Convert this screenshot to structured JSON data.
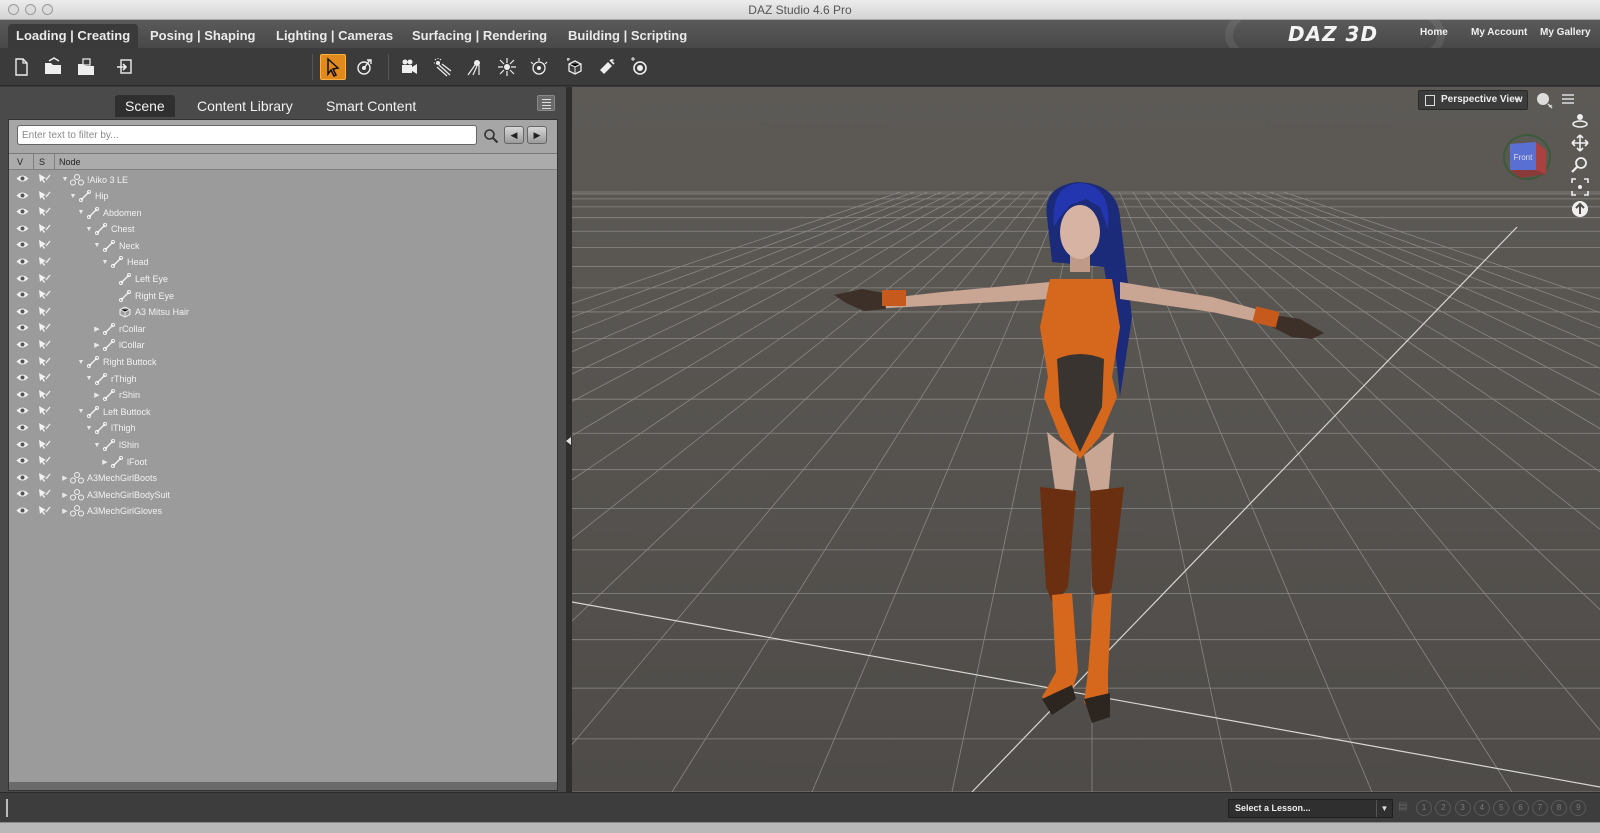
{
  "window": {
    "title": "DAZ Studio 4.6 Pro"
  },
  "workspace_tabs": [
    {
      "label": "Loading | Creating",
      "active": true
    },
    {
      "label": "Posing | Shaping",
      "active": false
    },
    {
      "label": "Lighting | Cameras",
      "active": false
    },
    {
      "label": "Surfacing | Rendering",
      "active": false
    },
    {
      "label": "Building | Scripting",
      "active": false
    }
  ],
  "brand": {
    "logo_text": "DAZ 3D"
  },
  "top_links": {
    "home": "Home",
    "account": "My Account",
    "gallery": "My Gallery"
  },
  "toolbar": {
    "file_tools": [
      "new-file-icon",
      "open-file-icon",
      "merge-file-icon",
      "import-icon"
    ],
    "active_tool": "node-selection-icon",
    "accent_color": "#e08a1e"
  },
  "pane": {
    "tabs": [
      {
        "label": "Scene",
        "active": true
      },
      {
        "label": "Content Library",
        "active": false
      },
      {
        "label": "Smart Content",
        "active": false
      }
    ],
    "filter_placeholder": "Enter text to filter by...",
    "columns": {
      "visible": "V",
      "selectable": "S",
      "node": "Node"
    }
  },
  "scene_nodes": [
    {
      "label": "!Aiko 3 LE",
      "depth": 0,
      "expand": "open",
      "icon": "figure"
    },
    {
      "label": "Hip",
      "depth": 1,
      "expand": "open",
      "icon": "bone"
    },
    {
      "label": "Abdomen",
      "depth": 2,
      "expand": "open",
      "icon": "bone"
    },
    {
      "label": "Chest",
      "depth": 3,
      "expand": "open",
      "icon": "bone"
    },
    {
      "label": "Neck",
      "depth": 4,
      "expand": "open",
      "icon": "bone"
    },
    {
      "label": "Head",
      "depth": 5,
      "expand": "open",
      "icon": "bone"
    },
    {
      "label": "Left Eye",
      "depth": 6,
      "expand": "none",
      "icon": "bone"
    },
    {
      "label": "Right Eye",
      "depth": 6,
      "expand": "none",
      "icon": "bone"
    },
    {
      "label": "A3 Mitsu Hair",
      "depth": 6,
      "expand": "none",
      "icon": "prop"
    },
    {
      "label": "rCollar",
      "depth": 4,
      "expand": "closed",
      "icon": "bone"
    },
    {
      "label": "lCollar",
      "depth": 4,
      "expand": "closed",
      "icon": "bone"
    },
    {
      "label": "Right Buttock",
      "depth": 2,
      "expand": "open",
      "icon": "bone"
    },
    {
      "label": "rThigh",
      "depth": 3,
      "expand": "open",
      "icon": "bone"
    },
    {
      "label": "rShin",
      "depth": 4,
      "expand": "closed",
      "icon": "bone"
    },
    {
      "label": "Left Buttock",
      "depth": 2,
      "expand": "open",
      "icon": "bone"
    },
    {
      "label": "lThigh",
      "depth": 3,
      "expand": "open",
      "icon": "bone"
    },
    {
      "label": "lShin",
      "depth": 4,
      "expand": "open",
      "icon": "bone"
    },
    {
      "label": "lFoot",
      "depth": 5,
      "expand": "closed",
      "icon": "bone"
    },
    {
      "label": "A3MechGirlBoots",
      "depth": 0,
      "expand": "closed",
      "icon": "figure"
    },
    {
      "label": "A3MechGirlBodySuit",
      "depth": 0,
      "expand": "closed",
      "icon": "figure"
    },
    {
      "label": "A3MechGirlGloves",
      "depth": 0,
      "expand": "closed",
      "icon": "figure"
    }
  ],
  "viewport": {
    "view_name": "Perspective View",
    "cube_face": "Front",
    "colors": {
      "suit": "#d5681c",
      "hair": "#1c2f9a",
      "skin": "#c9a593"
    }
  },
  "lessons": {
    "select_label": "Select a Lesson...",
    "steps": [
      "1",
      "2",
      "3",
      "4",
      "5",
      "6",
      "7",
      "8",
      "9"
    ]
  }
}
